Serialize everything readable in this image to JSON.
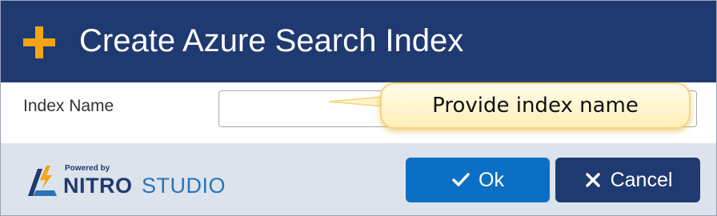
{
  "dialog": {
    "title": "Create Azure Search Index",
    "header_icon": "plus-icon",
    "accent_color": "#f2a516",
    "header_color": "#1f3a70"
  },
  "form": {
    "index_name_label": "Index Name",
    "index_name_value": "",
    "index_name_placeholder": ""
  },
  "callout": {
    "text": "Provide index name"
  },
  "footer": {
    "logo": {
      "powered_by": "Powered by",
      "brand_bold": "NITRO",
      "brand_light": "STUDIO"
    },
    "ok_label": "Ok",
    "ok_icon": "check-icon",
    "ok_color": "#0b70c4",
    "cancel_label": "Cancel",
    "cancel_icon": "close-icon",
    "cancel_color": "#1f3a70"
  }
}
